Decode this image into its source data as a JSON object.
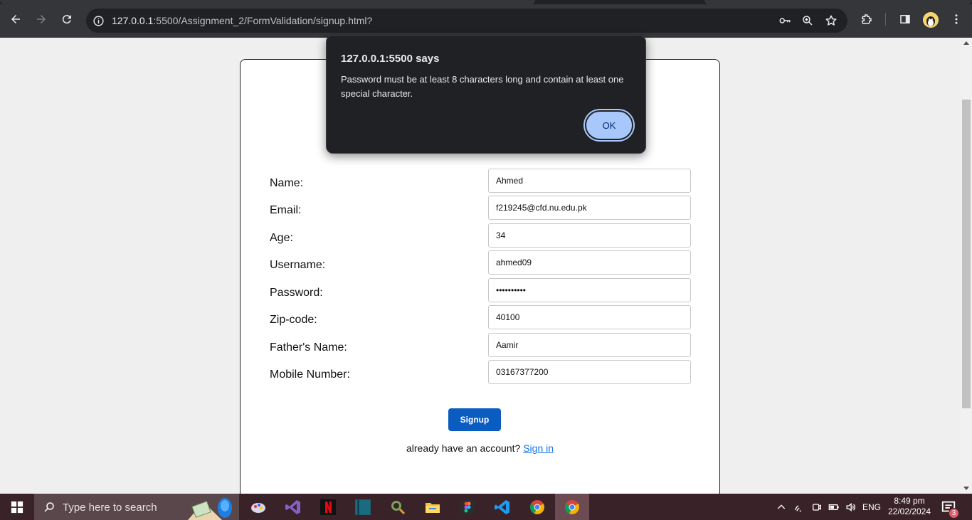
{
  "browser": {
    "url_host": "127.0.0.1",
    "url_rest": ":5500/Assignment_2/FormValidation/signup.html?",
    "icons": [
      "back-icon",
      "forward-icon",
      "reload-icon",
      "site-info-icon",
      "key-icon",
      "zoom-icon",
      "star-icon",
      "extensions-icon",
      "side-panel-icon",
      "profile-avatar",
      "menu-icon"
    ]
  },
  "form": {
    "fields": [
      {
        "label": "Name:",
        "value": "Ahmed"
      },
      {
        "label": "Email:",
        "value": "f219245@cfd.nu.edu.pk"
      },
      {
        "label": "Age:",
        "value": "34"
      },
      {
        "label": "Username:",
        "value": "ahmed09"
      },
      {
        "label": "Password:",
        "value": "••••••••••"
      },
      {
        "label": "Zip-code:",
        "value": "40100"
      },
      {
        "label": "Father's Name:",
        "value": "Aamir"
      },
      {
        "label": "Mobile Number:",
        "value": "03167377200"
      }
    ],
    "signup_label": "Signup",
    "signin_prompt": "already have an account?",
    "signin_link": "Sign in"
  },
  "alert": {
    "title": "127.0.0.1:5500 says",
    "message": "Password must be at least 8 characters long and contain at least one special character.",
    "ok_label": "OK"
  },
  "taskbar": {
    "search_placeholder": "Type here to search",
    "language": "ENG",
    "time": "8:49 pm",
    "date": "22/02/2024",
    "notification_count": "3",
    "colors": {
      "bar": "#3a2328",
      "accent": "#0a5cc1"
    }
  }
}
